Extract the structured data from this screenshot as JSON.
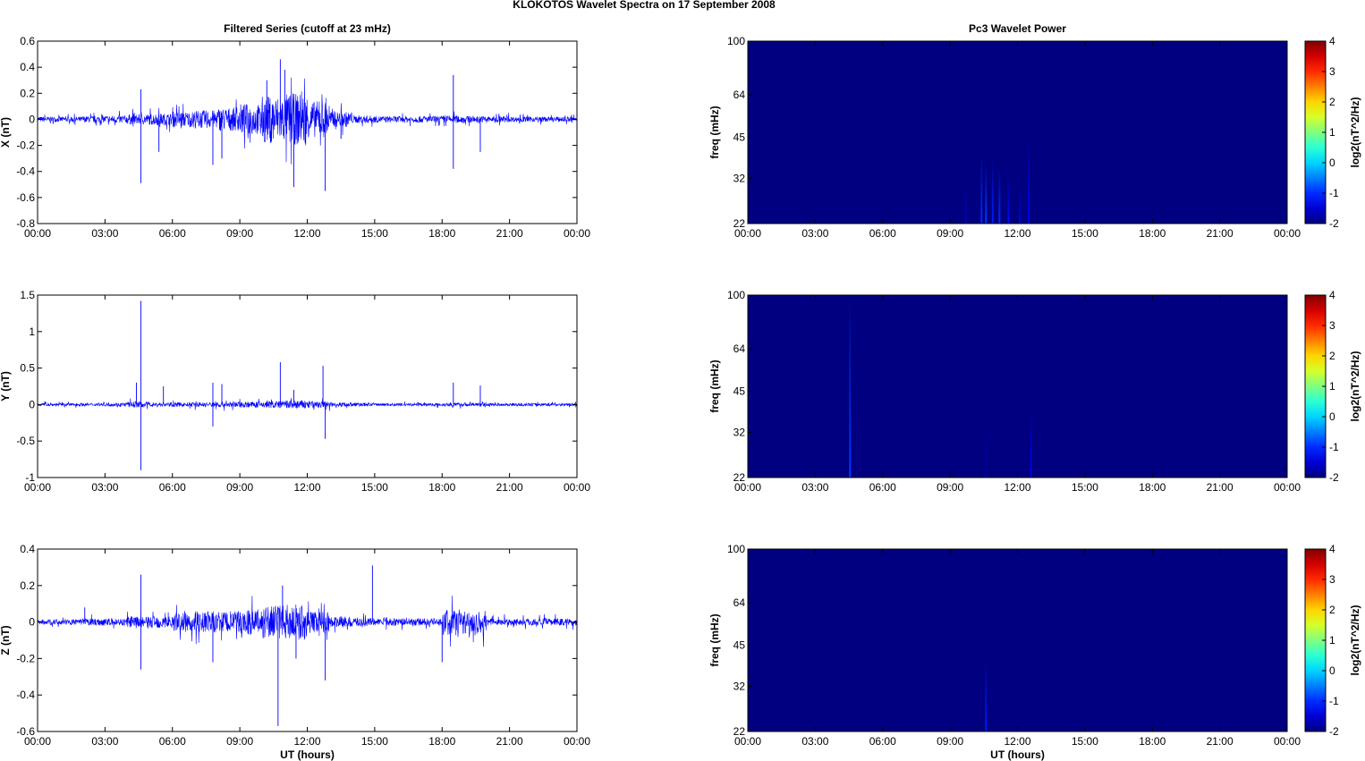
{
  "title": "KLOKOTOS Wavelet Spectra on 17 September 2008",
  "colors": {
    "series": "#0000ff",
    "axis": "#000000",
    "background_power": "#00008f"
  },
  "chart_data": [
    {
      "type": "line",
      "panel": "X",
      "title": "Filtered Series (cutoff at 23 mHz)",
      "ylabel": "X (nT)",
      "xlabel": "",
      "ylim": [
        -0.8,
        0.6
      ],
      "yticks": [
        "-0.8",
        "-0.6",
        "-0.4",
        "-0.2",
        "0",
        "0.2",
        "0.4",
        "0.6"
      ],
      "xticks": [
        "00:00",
        "03:00",
        "06:00",
        "09:00",
        "12:00",
        "15:00",
        "18:00",
        "21:00",
        "00:00"
      ],
      "xlim_hours": [
        0,
        24
      ],
      "noise_amplitude_by_hour": [
        0.02,
        0.02,
        0.025,
        0.03,
        0.04,
        0.045,
        0.06,
        0.07,
        0.09,
        0.12,
        0.18,
        0.2,
        0.14,
        0.06,
        0.03,
        0.025,
        0.025,
        0.025,
        0.03,
        0.025,
        0.025,
        0.02,
        0.02,
        0.02
      ],
      "spikes": [
        [
          4.6,
          0.23
        ],
        [
          4.6,
          -0.49
        ],
        [
          5.4,
          -0.25
        ],
        [
          7.8,
          -0.35
        ],
        [
          8.2,
          -0.3
        ],
        [
          10.2,
          0.3
        ],
        [
          10.8,
          0.46
        ],
        [
          11.0,
          0.38
        ],
        [
          11.4,
          -0.52
        ],
        [
          12.8,
          -0.55
        ],
        [
          13.5,
          -0.15
        ],
        [
          18.5,
          0.34
        ],
        [
          18.5,
          -0.38
        ],
        [
          19.7,
          -0.25
        ]
      ]
    },
    {
      "type": "line",
      "panel": "Y",
      "ylabel": "Y (nT)",
      "xlabel": "",
      "ylim": [
        -1,
        1.5
      ],
      "yticks": [
        "-1",
        "-0.5",
        "0",
        "0.5",
        "1",
        "1.5"
      ],
      "xticks": [
        "00:00",
        "03:00",
        "06:00",
        "09:00",
        "12:00",
        "15:00",
        "18:00",
        "21:00",
        "00:00"
      ],
      "xlim_hours": [
        0,
        24
      ],
      "noise_amplitude_by_hour": [
        0.02,
        0.02,
        0.02,
        0.025,
        0.04,
        0.03,
        0.03,
        0.035,
        0.04,
        0.04,
        0.05,
        0.06,
        0.05,
        0.03,
        0.025,
        0.02,
        0.02,
        0.02,
        0.025,
        0.025,
        0.02,
        0.02,
        0.02,
        0.02
      ],
      "spikes": [
        [
          4.6,
          1.42
        ],
        [
          4.6,
          -0.9
        ],
        [
          4.4,
          0.3
        ],
        [
          5.6,
          0.25
        ],
        [
          7.8,
          0.3
        ],
        [
          7.8,
          -0.3
        ],
        [
          8.2,
          0.28
        ],
        [
          10.8,
          0.58
        ],
        [
          11.4,
          0.2
        ],
        [
          12.7,
          0.53
        ],
        [
          12.8,
          -0.47
        ],
        [
          18.5,
          0.3
        ],
        [
          19.7,
          0.26
        ]
      ]
    },
    {
      "type": "line",
      "panel": "Z",
      "ylabel": "Z (nT)",
      "xlabel": "UT (hours)",
      "ylim": [
        -0.6,
        0.4
      ],
      "yticks": [
        "-0.6",
        "-0.4",
        "-0.2",
        "0",
        "0.2",
        "0.4"
      ],
      "xticks": [
        "00:00",
        "03:00",
        "06:00",
        "09:00",
        "12:00",
        "15:00",
        "18:00",
        "21:00",
        "00:00"
      ],
      "xlim_hours": [
        0,
        24
      ],
      "noise_amplitude_by_hour": [
        0.015,
        0.015,
        0.02,
        0.02,
        0.03,
        0.035,
        0.05,
        0.06,
        0.06,
        0.07,
        0.09,
        0.1,
        0.06,
        0.03,
        0.025,
        0.02,
        0.02,
        0.02,
        0.07,
        0.065,
        0.02,
        0.02,
        0.02,
        0.02
      ],
      "spikes": [
        [
          2.1,
          0.08
        ],
        [
          4.6,
          0.26
        ],
        [
          4.6,
          -0.26
        ],
        [
          7.8,
          -0.22
        ],
        [
          10.7,
          -0.57
        ],
        [
          10.9,
          0.2
        ],
        [
          11.5,
          -0.2
        ],
        [
          12.8,
          -0.32
        ],
        [
          14.9,
          0.31
        ],
        [
          18.0,
          -0.22
        ]
      ]
    },
    {
      "type": "heatmap",
      "panel": "X",
      "title": "Pc3 Wavelet Power",
      "ylabel": "freq (mHz)",
      "xlabel": "",
      "yticks": [
        "22",
        "32",
        "45",
        "64",
        "100"
      ],
      "yscale": "log",
      "ylim": [
        22,
        100
      ],
      "xticks": [
        "00:00",
        "03:00",
        "06:00",
        "09:00",
        "12:00",
        "15:00",
        "18:00",
        "21:00",
        "00:00"
      ],
      "colorbar": {
        "label": "log2(nT^2/Hz)",
        "ticks": [
          "-2",
          "-1",
          "0",
          "1",
          "2",
          "3",
          "4"
        ],
        "range": [
          -2,
          4
        ],
        "colormap": "jet"
      },
      "background_value": -2,
      "bursts": [
        [
          9.7,
          -1.6,
          32
        ],
        [
          10.4,
          -1.0,
          40
        ],
        [
          10.6,
          -0.9,
          36
        ],
        [
          10.9,
          -1.1,
          38
        ],
        [
          11.2,
          -1.0,
          35
        ],
        [
          11.6,
          -1.2,
          33
        ],
        [
          12.1,
          -1.4,
          30
        ],
        [
          12.5,
          -1.3,
          46
        ]
      ]
    },
    {
      "type": "heatmap",
      "panel": "Y",
      "ylabel": "freq (mHz)",
      "xlabel": "",
      "yticks": [
        "22",
        "32",
        "45",
        "64",
        "100"
      ],
      "yscale": "log",
      "ylim": [
        22,
        100
      ],
      "xticks": [
        "00:00",
        "03:00",
        "06:00",
        "09:00",
        "12:00",
        "15:00",
        "18:00",
        "21:00",
        "00:00"
      ],
      "colorbar": {
        "label": "log2(nT^2/Hz)",
        "ticks": [
          "-2",
          "-1",
          "0",
          "1",
          "2",
          "3",
          "4"
        ],
        "range": [
          -2,
          4
        ],
        "colormap": "jet"
      },
      "background_value": -2,
      "bursts": [
        [
          4.55,
          -0.9,
          100
        ],
        [
          10.6,
          -1.8,
          45
        ],
        [
          12.6,
          -1.3,
          40
        ]
      ]
    },
    {
      "type": "heatmap",
      "panel": "Z",
      "ylabel": "freq (mHz)",
      "xlabel": "UT (hours)",
      "yticks": [
        "22",
        "32",
        "45",
        "64",
        "100"
      ],
      "yscale": "log",
      "ylim": [
        22,
        100
      ],
      "xticks": [
        "00:00",
        "03:00",
        "06:00",
        "09:00",
        "12:00",
        "15:00",
        "18:00",
        "21:00",
        "00:00"
      ],
      "colorbar": {
        "label": "log2(nT^2/Hz)",
        "ticks": [
          "-2",
          "-1",
          "0",
          "1",
          "2",
          "3",
          "4"
        ],
        "range": [
          -2,
          4
        ],
        "colormap": "jet"
      },
      "background_value": -2,
      "bursts": [
        [
          10.6,
          -1.1,
          40
        ]
      ]
    }
  ]
}
